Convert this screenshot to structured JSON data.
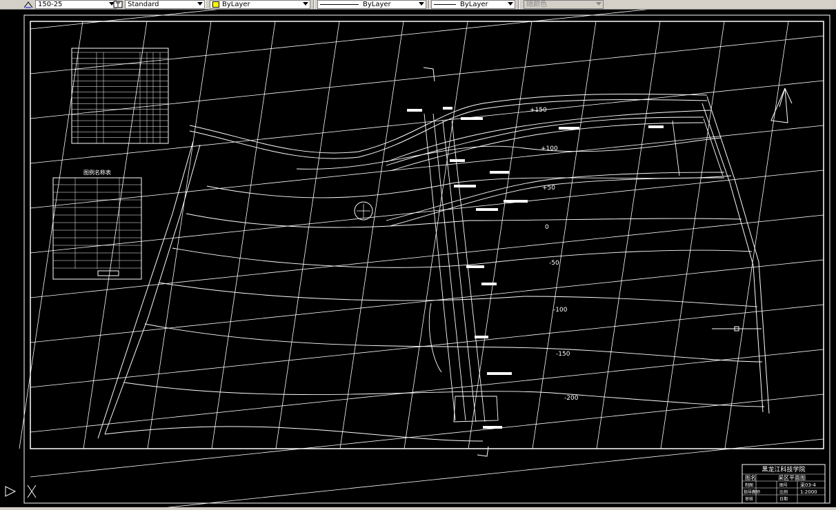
{
  "toolbar": {
    "dimstyle": "150-25",
    "textstyle": "Standard",
    "layer_color": "ByLayer",
    "linetype": "ByLayer",
    "lineweight": "ByLayer",
    "plotstyle": "随颜色"
  },
  "contours": {
    "c1": "+150",
    "c2": "+100",
    "c3": "+50",
    "c4": "0",
    "c5": "-50",
    "c6": "-100",
    "c7": "-150",
    "c8": "-200"
  },
  "table2": {
    "title": "图例名称表"
  },
  "titleblock": {
    "school": "黑龙江科技学院",
    "drawing_name": "采区平面图",
    "label_name": "图名",
    "r2_c1": "制图",
    "r2_c2": "图号",
    "r2_val": "采03-4",
    "r3_c1": "指导教师",
    "r3_c2": "比例",
    "r3_val": "1:2000",
    "r4_c1": "审核",
    "r4_c2": "日期"
  },
  "colors": {
    "background": "#000000",
    "lines": "#ffffff",
    "toolbar": "#d4d0c8"
  },
  "icons": [
    "dimstyle-icon",
    "textstyle-icon",
    "north-arrow-icon",
    "ucs-icon",
    "crosshair-cursor-icon"
  ]
}
